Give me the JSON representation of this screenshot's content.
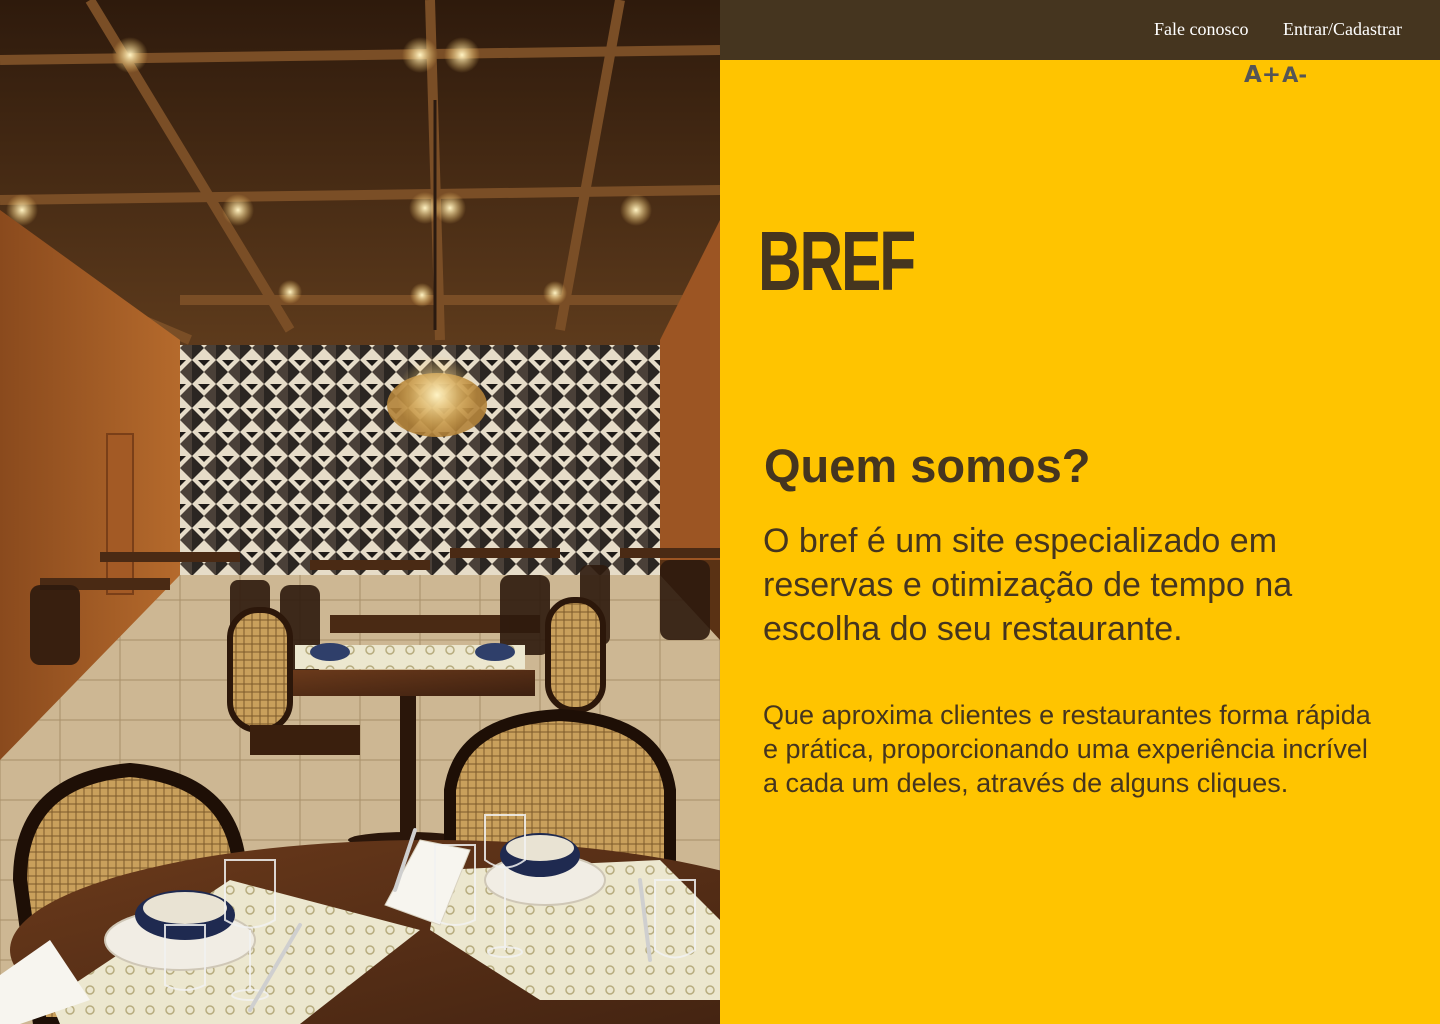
{
  "header": {
    "nav": {
      "contact_label": "Fale conosco",
      "login_label": "Entrar/Cadastrar"
    },
    "font_size_controls": {
      "increase_label": "A+",
      "decrease_label": "A-"
    }
  },
  "brand": {
    "logo_text": "BREF"
  },
  "about": {
    "title": "Quem somos?",
    "intro": "O bref é um site especializado em reservas e otimização de tempo na escolha do seu restaurante.",
    "body": "Que aproxima clientes e restaurantes forma rápida e prática, proporcionando uma experiência incrível a cada um deles, através de alguns cliques."
  },
  "colors": {
    "panel_background": "#FFC400",
    "topbar_background": "#45351F",
    "text_dark_brown": "#45351F",
    "font_control_gray": "#555555"
  }
}
